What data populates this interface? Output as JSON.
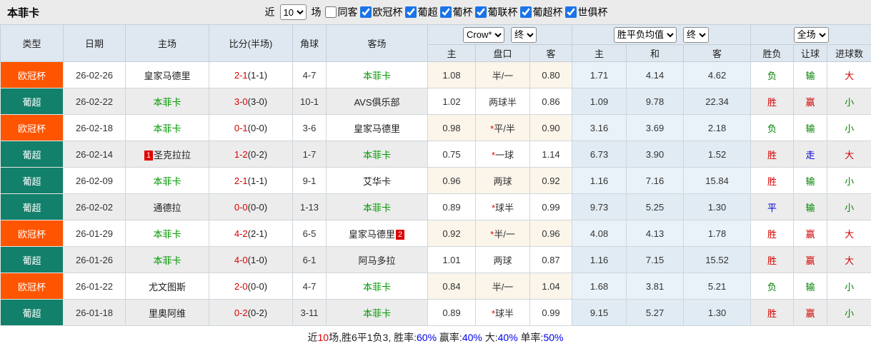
{
  "title": "本菲卡",
  "colors": {
    "league_orange": "#ff5500",
    "league_teal": "#12806b",
    "team_green": "#009900",
    "score_red": "#dd0000",
    "win_red": "#d40000",
    "lose_green": "#008200",
    "draw_blue": "#0000cc",
    "footer_blue": "#0000ee",
    "header_bg": "#dfe8f0"
  },
  "filter_bar": {
    "recent_label": "近",
    "recent_value": "10",
    "games_label": "场",
    "same_venue": {
      "label": "同客",
      "checked": false
    },
    "leagues": [
      {
        "label": "欧冠杯",
        "checked": true
      },
      {
        "label": "葡超",
        "checked": true
      },
      {
        "label": "葡杯",
        "checked": true
      },
      {
        "label": "葡联杯",
        "checked": true
      },
      {
        "label": "葡超杯",
        "checked": true
      },
      {
        "label": "世俱杯",
        "checked": true
      }
    ]
  },
  "table": {
    "left_columns": {
      "type": "类型",
      "date": "日期",
      "home": "主场",
      "score": "比分(半场)",
      "corner": "角球",
      "away": "客场"
    },
    "header": {
      "asian": {
        "select1": "Crow*",
        "select2": "终",
        "sub_home": "主",
        "sub_handicap": "盘口",
        "sub_away": "客"
      },
      "euro": {
        "select1": "胜平负均值",
        "select2": "终",
        "sub_home": "主",
        "sub_draw": "和",
        "sub_away": "客"
      },
      "result": {
        "select1": "全场",
        "sub_wl": "胜负",
        "sub_handicap": "让球",
        "sub_goals": "进球数"
      }
    },
    "rows": [
      {
        "league": "欧冠杯",
        "league_class": "bg-orange",
        "date": "26-02-26",
        "home": {
          "name": "皇家马德里",
          "benfica": false,
          "rank": ""
        },
        "score_ft": "2-1",
        "score_ht": "(1-1)",
        "corners": "4-7",
        "away": {
          "name": "本菲卡",
          "benfica": true,
          "rank": ""
        },
        "asian": {
          "home": "1.08",
          "star": false,
          "handicap": "半/一",
          "away": "0.80"
        },
        "euro": {
          "home": "1.71",
          "draw": "4.14",
          "away": "4.62"
        },
        "results": [
          {
            "text": "负",
            "c": "green"
          },
          {
            "text": "输",
            "c": "green"
          },
          {
            "text": "大",
            "c": "red"
          }
        ]
      },
      {
        "league": "葡超",
        "league_class": "bg-teal",
        "date": "26-02-22",
        "home": {
          "name": "本菲卡",
          "benfica": true,
          "rank": ""
        },
        "score_ft": "3-0",
        "score_ht": "(3-0)",
        "corners": "10-1",
        "away": {
          "name": "AVS俱乐部",
          "benfica": false,
          "rank": ""
        },
        "asian": {
          "home": "1.02",
          "star": false,
          "handicap": "两球半",
          "away": "0.86"
        },
        "euro": {
          "home": "1.09",
          "draw": "9.78",
          "away": "22.34"
        },
        "results": [
          {
            "text": "胜",
            "c": "red"
          },
          {
            "text": "赢",
            "c": "red"
          },
          {
            "text": "小",
            "c": "green"
          }
        ]
      },
      {
        "league": "欧冠杯",
        "league_class": "bg-orange",
        "date": "26-02-18",
        "home": {
          "name": "本菲卡",
          "benfica": true,
          "rank": ""
        },
        "score_ft": "0-1",
        "score_ht": "(0-0)",
        "corners": "3-6",
        "away": {
          "name": "皇家马德里",
          "benfica": false,
          "rank": ""
        },
        "asian": {
          "home": "0.98",
          "star": true,
          "handicap": "平/半",
          "away": "0.90"
        },
        "euro": {
          "home": "3.16",
          "draw": "3.69",
          "away": "2.18"
        },
        "results": [
          {
            "text": "负",
            "c": "green"
          },
          {
            "text": "输",
            "c": "green"
          },
          {
            "text": "小",
            "c": "green"
          }
        ]
      },
      {
        "league": "葡超",
        "league_class": "bg-teal",
        "date": "26-02-14",
        "home": {
          "name": "圣克拉拉",
          "benfica": false,
          "rank": "1"
        },
        "score_ft": "1-2",
        "score_ht": "(0-2)",
        "corners": "1-7",
        "away": {
          "name": "本菲卡",
          "benfica": true,
          "rank": ""
        },
        "asian": {
          "home": "0.75",
          "star": true,
          "handicap": "一球",
          "away": "1.14"
        },
        "euro": {
          "home": "6.73",
          "draw": "3.90",
          "away": "1.52"
        },
        "results": [
          {
            "text": "胜",
            "c": "red"
          },
          {
            "text": "走",
            "c": "blue"
          },
          {
            "text": "大",
            "c": "red"
          }
        ]
      },
      {
        "league": "葡超",
        "league_class": "bg-teal",
        "date": "26-02-09",
        "home": {
          "name": "本菲卡",
          "benfica": true,
          "rank": ""
        },
        "score_ft": "2-1",
        "score_ht": "(1-1)",
        "corners": "9-1",
        "away": {
          "name": "艾华卡",
          "benfica": false,
          "rank": ""
        },
        "asian": {
          "home": "0.96",
          "star": false,
          "handicap": "两球",
          "away": "0.92"
        },
        "euro": {
          "home": "1.16",
          "draw": "7.16",
          "away": "15.84"
        },
        "results": [
          {
            "text": "胜",
            "c": "red"
          },
          {
            "text": "输",
            "c": "green"
          },
          {
            "text": "小",
            "c": "green"
          }
        ]
      },
      {
        "league": "葡超",
        "league_class": "bg-teal",
        "date": "26-02-02",
        "home": {
          "name": "通德拉",
          "benfica": false,
          "rank": ""
        },
        "score_ft": "0-0",
        "score_ht": "(0-0)",
        "corners": "1-13",
        "away": {
          "name": "本菲卡",
          "benfica": true,
          "rank": ""
        },
        "asian": {
          "home": "0.89",
          "star": true,
          "handicap": "球半",
          "away": "0.99"
        },
        "euro": {
          "home": "9.73",
          "draw": "5.25",
          "away": "1.30"
        },
        "results": [
          {
            "text": "平",
            "c": "blue"
          },
          {
            "text": "输",
            "c": "green"
          },
          {
            "text": "小",
            "c": "green"
          }
        ]
      },
      {
        "league": "欧冠杯",
        "league_class": "bg-orange",
        "date": "26-01-29",
        "home": {
          "name": "本菲卡",
          "benfica": true,
          "rank": ""
        },
        "score_ft": "4-2",
        "score_ht": "(2-1)",
        "corners": "6-5",
        "away": {
          "name": "皇家马德里",
          "benfica": false,
          "rank": "2"
        },
        "asian": {
          "home": "0.92",
          "star": true,
          "handicap": "半/一",
          "away": "0.96"
        },
        "euro": {
          "home": "4.08",
          "draw": "4.13",
          "away": "1.78"
        },
        "results": [
          {
            "text": "胜",
            "c": "red"
          },
          {
            "text": "赢",
            "c": "red"
          },
          {
            "text": "大",
            "c": "red"
          }
        ]
      },
      {
        "league": "葡超",
        "league_class": "bg-teal",
        "date": "26-01-26",
        "home": {
          "name": "本菲卡",
          "benfica": true,
          "rank": ""
        },
        "score_ft": "4-0",
        "score_ht": "(1-0)",
        "corners": "6-1",
        "away": {
          "name": "阿马多拉",
          "benfica": false,
          "rank": ""
        },
        "asian": {
          "home": "1.01",
          "star": false,
          "handicap": "两球",
          "away": "0.87"
        },
        "euro": {
          "home": "1.16",
          "draw": "7.15",
          "away": "15.52"
        },
        "results": [
          {
            "text": "胜",
            "c": "red"
          },
          {
            "text": "赢",
            "c": "red"
          },
          {
            "text": "大",
            "c": "red"
          }
        ]
      },
      {
        "league": "欧冠杯",
        "league_class": "bg-orange",
        "date": "26-01-22",
        "home": {
          "name": "尤文图斯",
          "benfica": false,
          "rank": ""
        },
        "score_ft": "2-0",
        "score_ht": "(0-0)",
        "corners": "4-7",
        "away": {
          "name": "本菲卡",
          "benfica": true,
          "rank": ""
        },
        "asian": {
          "home": "0.84",
          "star": false,
          "handicap": "半/一",
          "away": "1.04"
        },
        "euro": {
          "home": "1.68",
          "draw": "3.81",
          "away": "5.21"
        },
        "results": [
          {
            "text": "负",
            "c": "green"
          },
          {
            "text": "输",
            "c": "green"
          },
          {
            "text": "小",
            "c": "green"
          }
        ]
      },
      {
        "league": "葡超",
        "league_class": "bg-teal",
        "date": "26-01-18",
        "home": {
          "name": "里奥阿维",
          "benfica": false,
          "rank": ""
        },
        "score_ft": "0-2",
        "score_ht": "(0-2)",
        "corners": "3-11",
        "away": {
          "name": "本菲卡",
          "benfica": true,
          "rank": ""
        },
        "asian": {
          "home": "0.89",
          "star": true,
          "handicap": "球半",
          "away": "0.99"
        },
        "euro": {
          "home": "9.15",
          "draw": "5.27",
          "away": "1.30"
        },
        "results": [
          {
            "text": "胜",
            "c": "red"
          },
          {
            "text": "赢",
            "c": "red"
          },
          {
            "text": "小",
            "c": "green"
          }
        ]
      }
    ]
  },
  "footer": {
    "segments": [
      {
        "text": "近",
        "c": "black"
      },
      {
        "text": "10",
        "c": "red"
      },
      {
        "text": "场,胜6平1负3, 胜率:",
        "c": "black"
      },
      {
        "text": "60%",
        "c": "blue"
      },
      {
        "text": " 赢率:",
        "c": "black"
      },
      {
        "text": "40%",
        "c": "blue"
      },
      {
        "text": " 大:",
        "c": "black"
      },
      {
        "text": "40%",
        "c": "blue"
      },
      {
        "text": " 单率:",
        "c": "black"
      },
      {
        "text": "50%",
        "c": "blue"
      }
    ]
  }
}
